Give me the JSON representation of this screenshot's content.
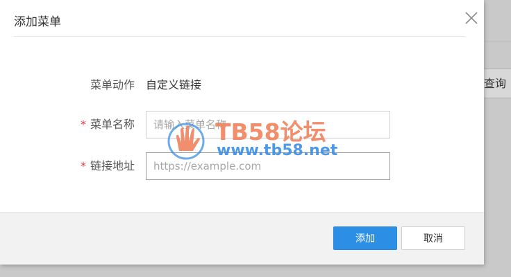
{
  "background": {
    "query_button_label": "查询"
  },
  "dialog": {
    "title": "添加菜单",
    "fields": {
      "action": {
        "label": "菜单动作",
        "value": "自定义链接"
      },
      "name": {
        "label": "菜单名称",
        "required_mark": "*",
        "placeholder": "请输入菜单名称",
        "value": ""
      },
      "link": {
        "label": "链接地址",
        "required_mark": "*",
        "placeholder": "https://example.com",
        "value": ""
      }
    },
    "buttons": {
      "add": "添加",
      "cancel": "取消"
    }
  },
  "watermark": {
    "brand": "TB58论坛",
    "url": "www.tb58.net"
  },
  "icons": {
    "close": "close-icon",
    "watermark_logo": "hand-logo-icon"
  },
  "colors": {
    "primary": "#2d8ee6",
    "required": "#e0393e",
    "watermark_orange": "#f0825d",
    "watermark_blue": "#3a8fe6"
  }
}
